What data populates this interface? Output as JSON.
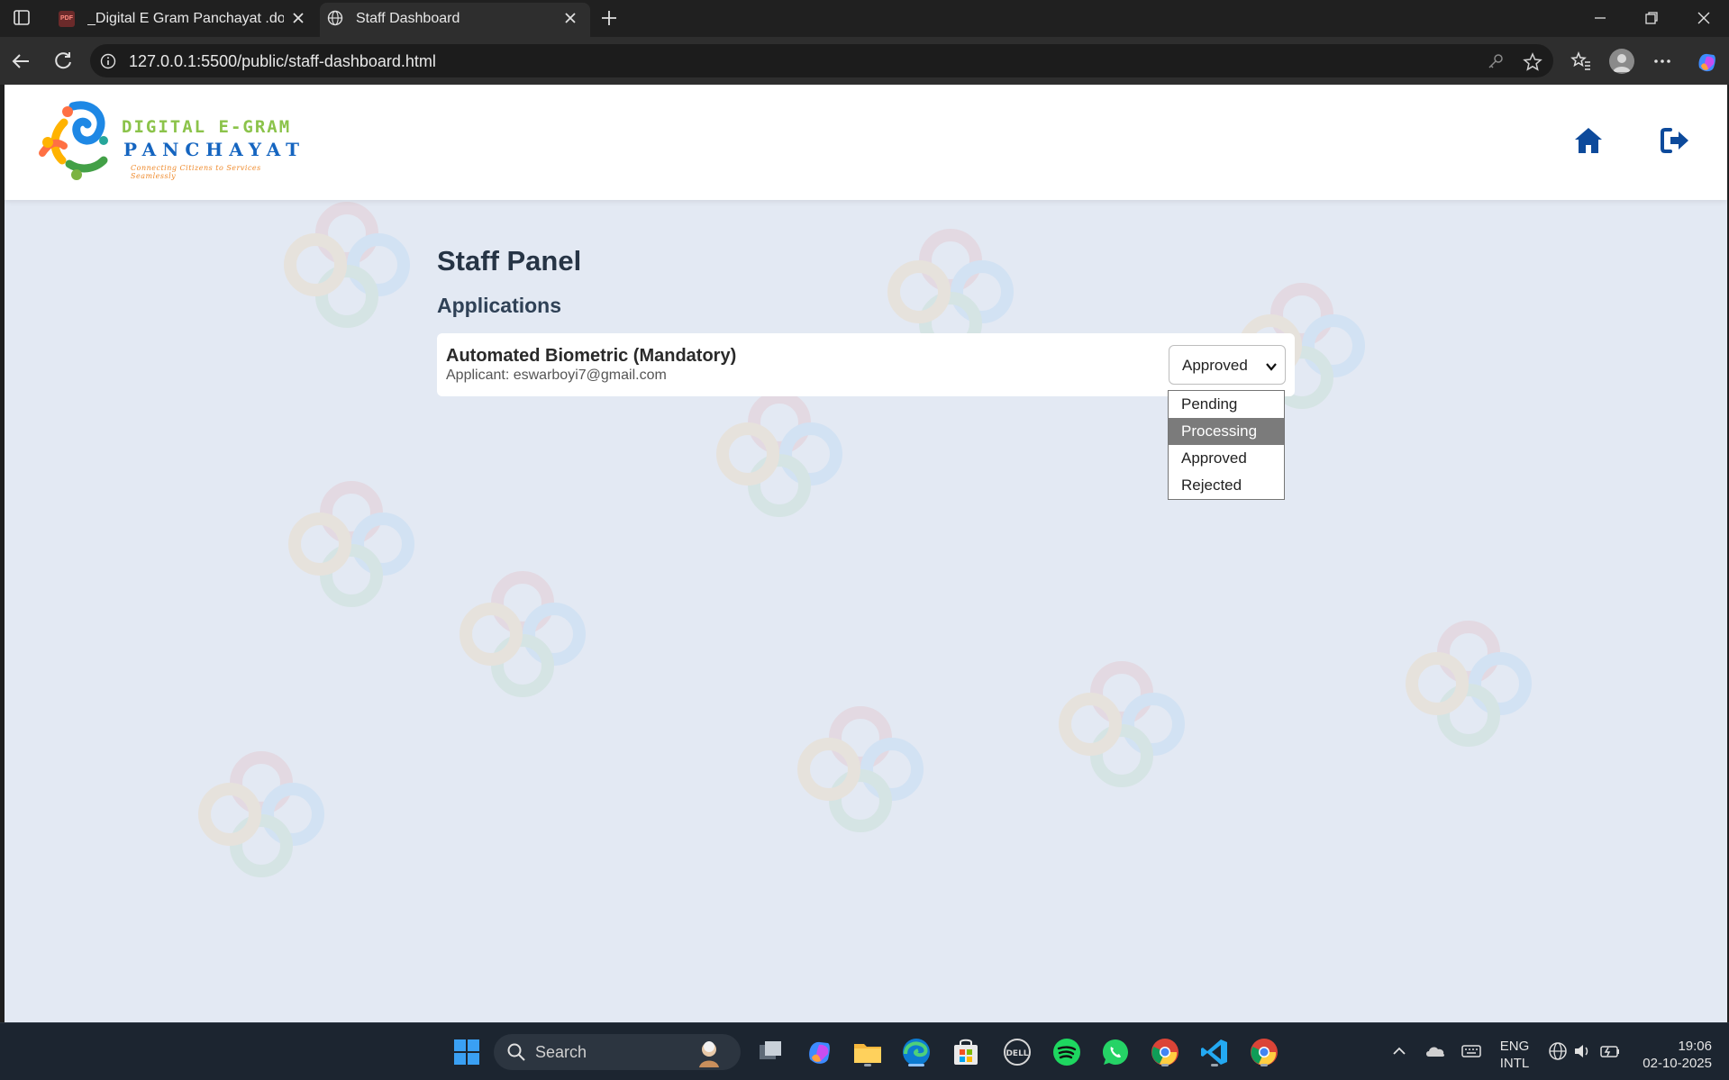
{
  "browser": {
    "tabs": [
      {
        "title": "_Digital E Gram Panchayat .docx.p",
        "favicon": "pdf-icon",
        "favicon_text": "PDF"
      },
      {
        "title": "Staff Dashboard",
        "favicon": "globe-icon"
      }
    ],
    "url": "127.0.0.1:5500/public/staff-dashboard.html"
  },
  "site": {
    "logo": {
      "line1": "DIGITAL E-GRAM",
      "line2": "PANCHAYAT",
      "tagline": "Connecting Citizens to Services Seamlessly"
    },
    "nav": {
      "home_icon": "home-icon",
      "logout_icon": "logout-icon"
    }
  },
  "page": {
    "title": "Staff Panel",
    "section_title": "Applications",
    "applications": [
      {
        "title": "Automated Biometric (Mandatory)",
        "applicant": "Applicant: eswarboyi7@gmail.com",
        "status": "Approved"
      }
    ],
    "status_options": [
      "Pending",
      "Processing",
      "Approved",
      "Rejected"
    ],
    "highlighted_option": "Processing"
  },
  "taskbar": {
    "search_label": "Search",
    "language_line1": "ENG",
    "language_line2": "INTL",
    "time": "19:06",
    "date": "02-10-2025"
  },
  "colors": {
    "page_bg": "#e3e9f3",
    "header_icon": "#0d4a9b",
    "title": "#263445",
    "highlight": "#7b7b7b"
  }
}
